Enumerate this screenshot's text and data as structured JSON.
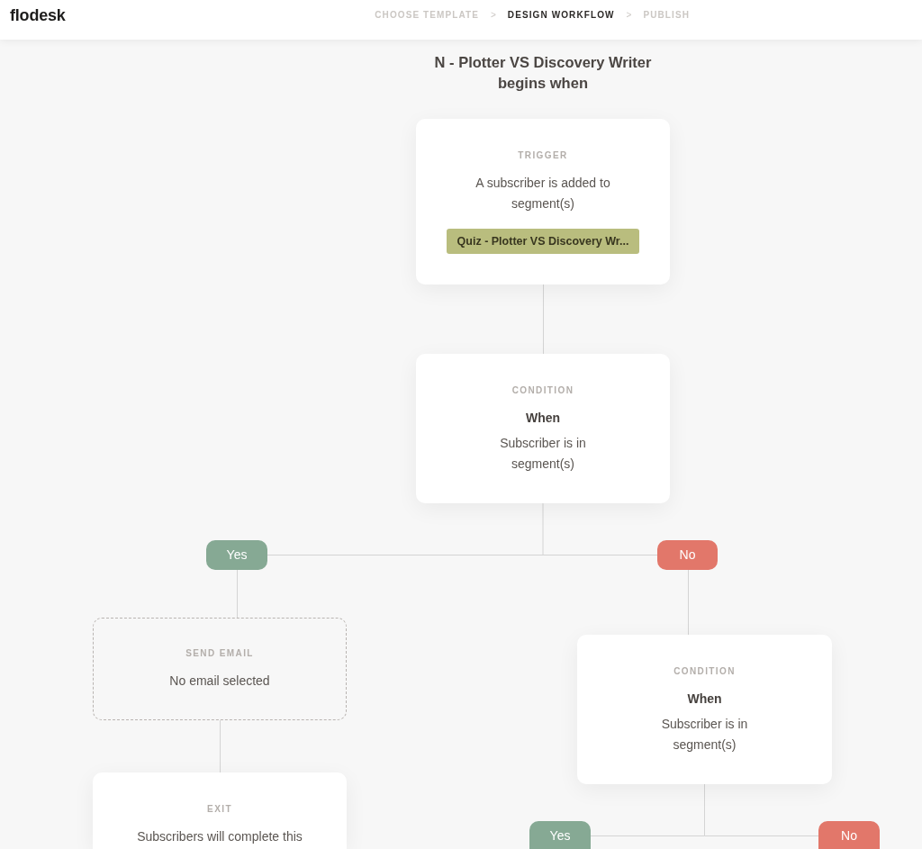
{
  "app": {
    "logo": "flodesk"
  },
  "steps": [
    {
      "label": "CHOOSE TEMPLATE",
      "selected": false
    },
    {
      "label": "DESIGN WORKFLOW",
      "selected": true
    },
    {
      "label": "PUBLISH",
      "selected": false
    }
  ],
  "step_separators": [
    ">",
    ">"
  ],
  "workflow": {
    "title": "N - Plotter VS Discovery Writer begins when",
    "steps": [
      {
        "kind": "trigger",
        "label": "TRIGGER",
        "text": "A subscriber is added to segment(s)",
        "segment": "Quiz - Plotter VS Discovery Wr..."
      },
      {
        "kind": "condition",
        "label": "CONDITION",
        "heading": "When",
        "text": "Subscriber is in segment(s)",
        "branches": [
          {
            "kind": "yes",
            "label": "Yes",
            "steps": [
              {
                "kind": "send_email",
                "label": "SEND EMAIL",
                "text": "No email selected"
              },
              {
                "kind": "exit",
                "label": "EXIT",
                "text": "Subscribers will complete this"
              }
            ]
          },
          {
            "kind": "no",
            "label": "No",
            "steps": [
              {
                "kind": "condition",
                "label": "CONDITION",
                "heading": "When",
                "text": "Subscriber is in segment(s)",
                "branches": [
                  {
                    "kind": "yes",
                    "label": "Yes"
                  },
                  {
                    "kind": "no",
                    "label": "No"
                  }
                ]
              }
            ]
          }
        ]
      }
    ]
  }
}
